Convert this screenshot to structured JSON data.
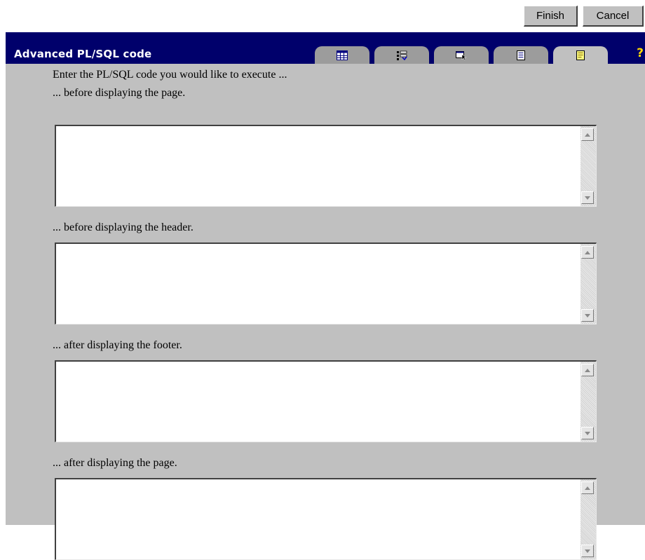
{
  "toolbar": {
    "finish_label": "Finish",
    "cancel_label": "Cancel"
  },
  "header": {
    "title": "Advanced PL/SQL code",
    "help_label": "?",
    "tabs": [
      {
        "icon": "table-grid-icon",
        "active": false
      },
      {
        "icon": "columns-select-icon",
        "active": false
      },
      {
        "icon": "window-cursor-icon",
        "active": false
      },
      {
        "icon": "document-icon",
        "active": false
      },
      {
        "icon": "code-page-icon",
        "active": true
      }
    ]
  },
  "form": {
    "intro": "Enter the PL/SQL code you would like to execute ...",
    "sections": [
      {
        "label": "... before displaying the page.",
        "value": ""
      },
      {
        "label": "... before displaying the header.",
        "value": ""
      },
      {
        "label": "... after displaying the footer.",
        "value": ""
      },
      {
        "label": "... after displaying the page.",
        "value": ""
      }
    ]
  },
  "colors": {
    "header_bg": "#00006b",
    "panel_bg": "#c0c0c0",
    "tab_bg": "#9c9c9c",
    "help_color": "#ffd800"
  }
}
